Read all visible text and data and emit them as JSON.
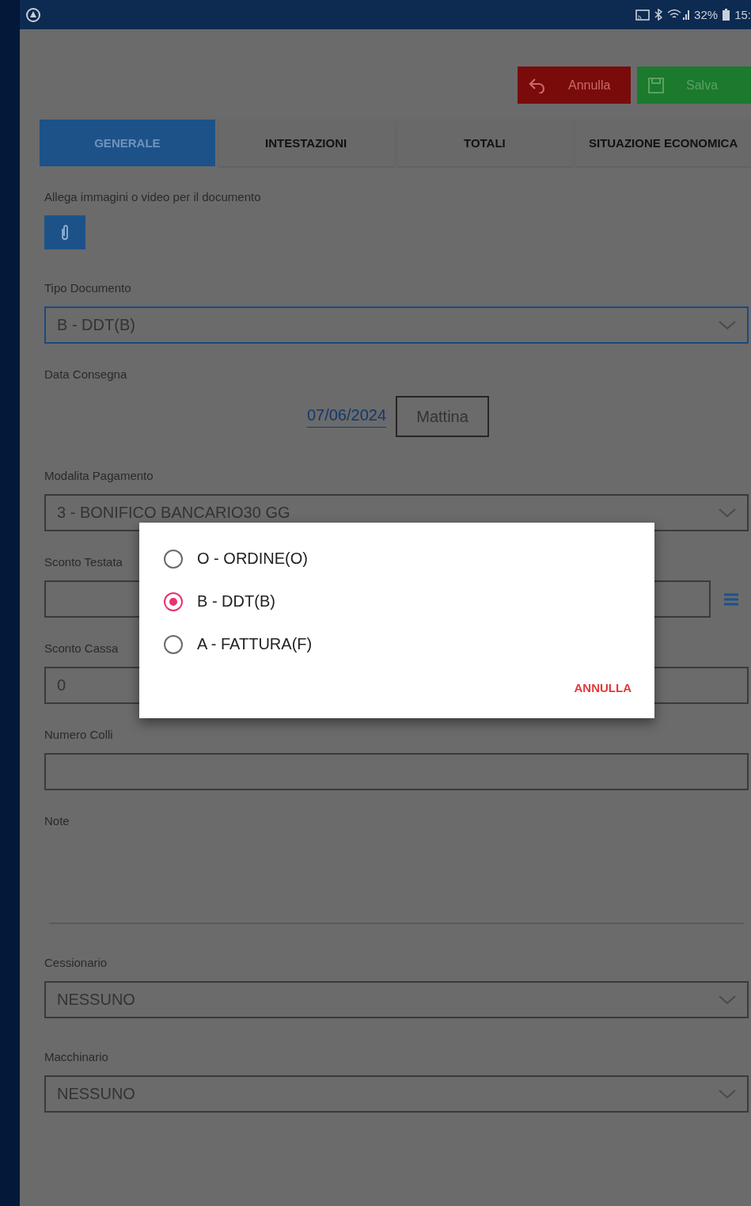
{
  "status_bar": {
    "battery": "32%",
    "time": "15:"
  },
  "toolbar": {
    "buttons": [
      {
        "kind": "cancel",
        "label": "Annulla"
      },
      {
        "kind": "save",
        "label": "Salva"
      }
    ]
  },
  "tabs": [
    {
      "label": "GENERALE",
      "selected": true
    },
    {
      "label": "INTESTAZIONI",
      "selected": false
    },
    {
      "label": "TOTALI",
      "selected": false
    },
    {
      "label": "SITUAZIONE ECONOMICA",
      "selected": false
    }
  ],
  "attachments": {
    "label": "Allega immagini o video per il documento"
  },
  "fields": [
    {
      "kind": "select",
      "label": "Tipo Documento",
      "value": "B - DDT(B)",
      "focused": true
    },
    {
      "kind": "date",
      "label": "Data Consegna",
      "date": "07/06/2024",
      "time_slot": "Mattina"
    },
    {
      "kind": "select",
      "label": "Modalita Pagamento",
      "value": "3 - BONIFICO BANCARIO30 GG",
      "focused": false
    },
    {
      "kind": "input_menu",
      "label": "Sconto Testata"
    },
    {
      "kind": "input",
      "label": "Sconto Cassa",
      "value": "0"
    },
    {
      "kind": "input",
      "label": "Numero Colli"
    },
    {
      "kind": "textarea",
      "label": "Note"
    },
    {
      "kind": "select",
      "label": "Cessionario",
      "value": "NESSUNO",
      "focused": false
    },
    {
      "kind": "select",
      "label": "Macchinario",
      "value": "NESSUNO",
      "focused": false
    }
  ],
  "dialog": {
    "options": [
      {
        "label": "O - ORDINE(O)",
        "selected": false
      },
      {
        "label": "B - DDT(B)",
        "selected": true
      },
      {
        "label": "A - FATTURA(F)",
        "selected": false
      }
    ],
    "cancel": "ANNULLA"
  }
}
